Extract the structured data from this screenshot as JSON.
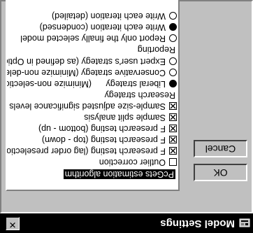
{
  "window": {
    "title": "Model Settings",
    "close_glyph": "✕"
  },
  "buttons": {
    "ok": "OK",
    "cancel": "Cancel"
  },
  "list": {
    "selected_item": "PcGets estimation algorithm",
    "algorithm_options": [
      {
        "label": "Outlier correction",
        "checked": false
      },
      {
        "label": "F presearch testing (lag order preselection)",
        "checked": true
      },
      {
        "label": "F presearch testing (top - down)",
        "checked": true
      },
      {
        "label": "F presearch testing (bottom - up)",
        "checked": true
      },
      {
        "label": "Sample split analysis",
        "checked": true
      },
      {
        "label": "Sample-size adjusted significance levels",
        "checked": true
      }
    ],
    "research_strategy_heading": "Research strategy",
    "strategies": [
      {
        "label": "Liberal strategy",
        "desc": "(Minimize non-selectio",
        "selected": true
      },
      {
        "label": "Conservative strategy (Minimize non-deletion",
        "desc": "",
        "selected": false
      },
      {
        "label": "Expert user's strategy (as defined in Options",
        "desc": "",
        "selected": false
      }
    ],
    "reporting_heading": "Reporting",
    "reporting": [
      {
        "label": "Report only the finally selected model",
        "selected": false
      },
      {
        "label": "Write each iteration (condensed)",
        "selected": true
      },
      {
        "label": "Write each iteration (detailed)",
        "selected": false
      }
    ]
  }
}
